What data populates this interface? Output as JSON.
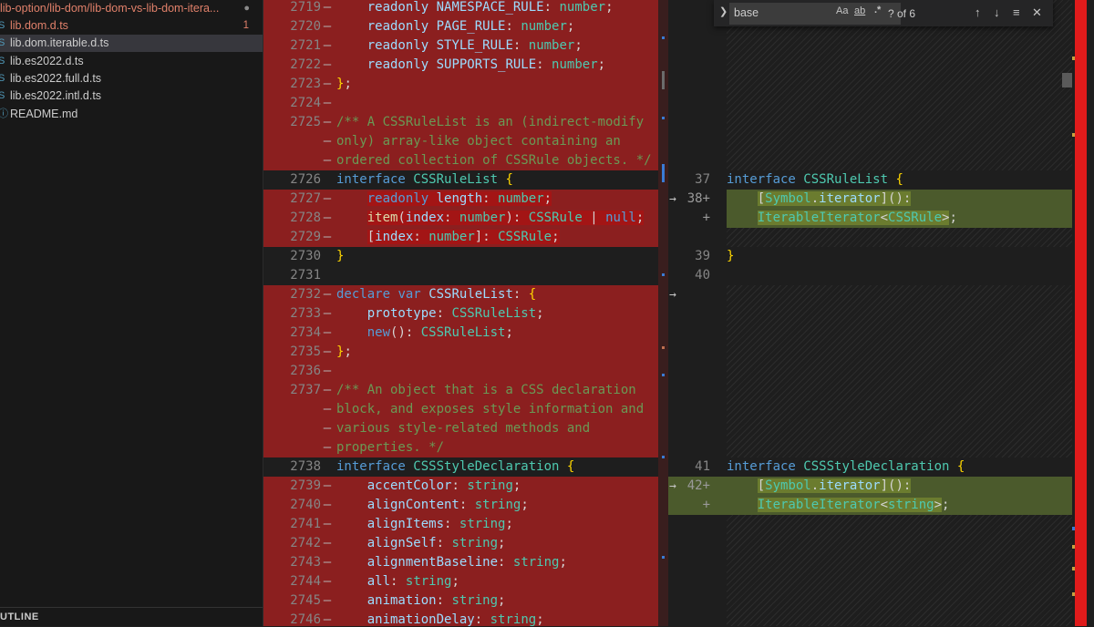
{
  "sidebar": {
    "path": "lib-option/lib-dom/lib-dom-vs-lib-dom-itera...",
    "files": [
      {
        "name": "lib.dom.d.ts",
        "badge": "1",
        "icon": "S"
      },
      {
        "name": "lib.dom.iterable.d.ts",
        "badge": "",
        "icon": "S"
      },
      {
        "name": "lib.es2022.d.ts",
        "badge": "",
        "icon": "S"
      },
      {
        "name": "lib.es2022.full.d.ts",
        "badge": "",
        "icon": "S"
      },
      {
        "name": "lib.es2022.intl.d.ts",
        "badge": "",
        "icon": "S"
      },
      {
        "name": "README.md",
        "badge": "",
        "icon": "ⓘ"
      }
    ],
    "outline": "UTLINE"
  },
  "find": {
    "value": "base",
    "case_label": "Aa",
    "word_label": "ab",
    "regex_label": ".*",
    "count": "? of 6"
  },
  "left": {
    "nums": [
      "2719",
      "2720",
      "2721",
      "2722",
      "2723",
      "2724",
      "2725",
      "",
      "",
      "2726",
      "2727",
      "2728",
      "2729",
      "2730",
      "2731",
      "2732",
      "2733",
      "2734",
      "2735",
      "2736",
      "2737",
      "",
      "",
      "",
      "2738",
      "2739",
      "2740",
      "2741",
      "2742",
      "2743",
      "2744",
      "2745",
      "2746"
    ]
  },
  "right": {
    "nums": [
      "37",
      "38+",
      "+",
      "39",
      "40",
      "41",
      "42+",
      "+"
    ]
  },
  "colors": {
    "deleted": "#8b1f1f",
    "inserted": "#4b5a2c",
    "keyword": "#569cd6",
    "type": "#4ec9b0",
    "comment": "#6a9955"
  }
}
